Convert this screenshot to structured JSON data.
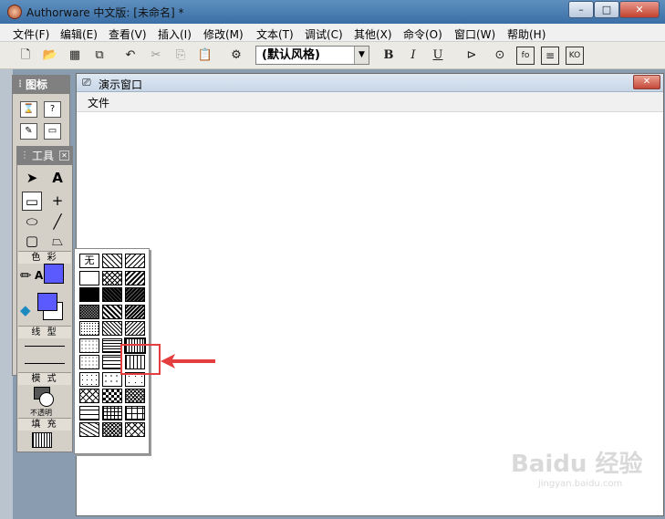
{
  "window": {
    "title": "Authorware 中文版: [未命名] *",
    "minimize": "–",
    "maximize": "□",
    "close": "✕"
  },
  "menubar": [
    "文件(F)",
    "编辑(E)",
    "查看(V)",
    "插入(I)",
    "修改(M)",
    "文本(T)",
    "调试(C)",
    "其他(X)",
    "命令(O)",
    "窗口(W)",
    "帮助(H)"
  ],
  "toolbar": {
    "style_value": "(默认风格)",
    "bold": "B",
    "italic": "I",
    "underline": "U"
  },
  "presentation": {
    "title": "演示窗口",
    "close": "✕",
    "menu": [
      "文件"
    ]
  },
  "icon_palette": {
    "title": "图标"
  },
  "tools": {
    "title": "工具",
    "color_label": "色 彩",
    "line_label": "线 型",
    "mode_label": "模 式",
    "mode_value": "不透明",
    "fill_label": "填 充"
  },
  "fill_popup": {
    "none_label": "无",
    "rows": 12,
    "cols": 3,
    "selected": "vertical-lines"
  },
  "colors": {
    "stroke_color": "#5a5aff",
    "fill_color": "#5a5aff",
    "highlight": "#e53e3e",
    "titlebar": "#3a6fa6"
  },
  "watermark": {
    "text": "Baidu 经验",
    "url_text": "jingyan.baidu.com"
  }
}
